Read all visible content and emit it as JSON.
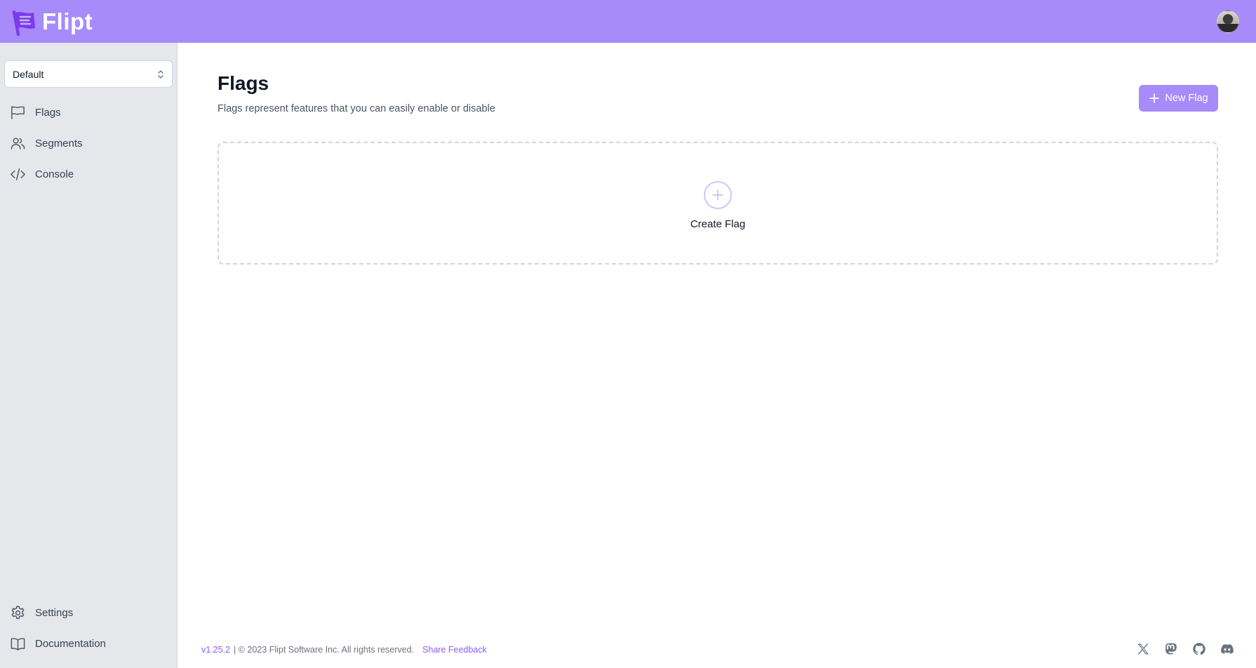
{
  "app": {
    "brand": "Flipt"
  },
  "colors": {
    "accent": "#a78bfa",
    "sidebar_bg": "#e5e7eb",
    "link": "#8b5cf6"
  },
  "sidebar": {
    "namespace": {
      "selected": "Default"
    },
    "items": [
      {
        "label": "Flags",
        "icon": "flag-icon"
      },
      {
        "label": "Segments",
        "icon": "users-icon"
      },
      {
        "label": "Console",
        "icon": "code-icon"
      }
    ],
    "bottom_items": [
      {
        "label": "Settings",
        "icon": "gear-icon"
      },
      {
        "label": "Documentation",
        "icon": "book-icon"
      }
    ]
  },
  "main": {
    "title": "Flags",
    "subtitle": "Flags represent features that you can easily enable or disable",
    "new_button_label": "New Flag",
    "empty_state_label": "Create Flag"
  },
  "footer": {
    "version": "v1.25.2",
    "copyright": "| © 2023 Flipt Software Inc. All rights reserved.",
    "feedback_label": "Share Feedback",
    "socials": [
      "x-icon",
      "mastodon-icon",
      "github-icon",
      "discord-icon"
    ]
  }
}
